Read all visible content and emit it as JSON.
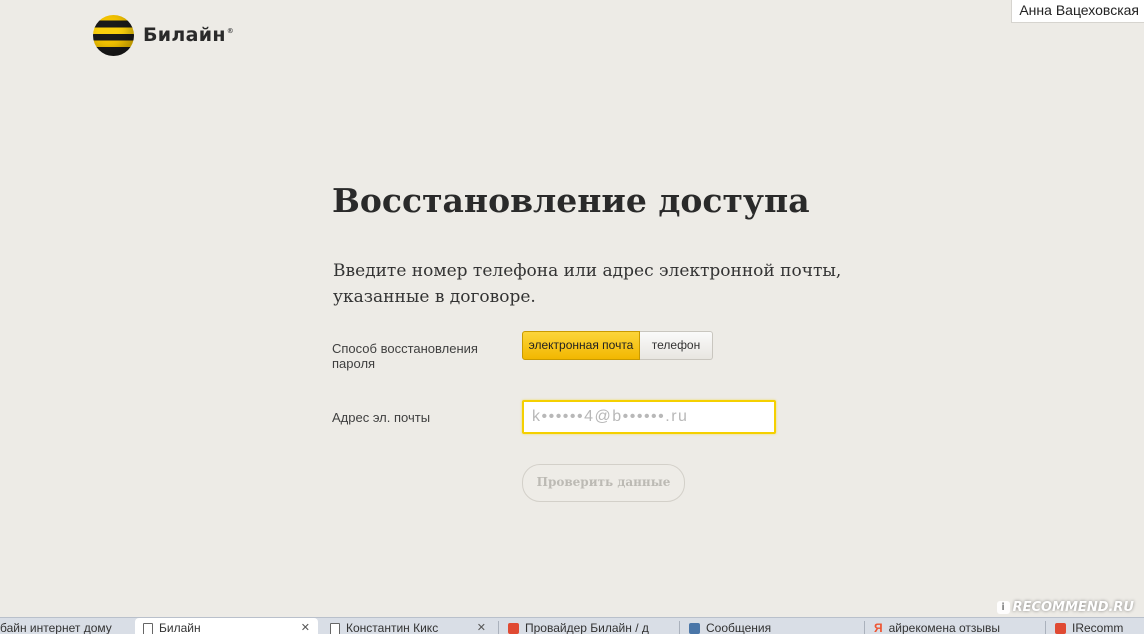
{
  "header": {
    "user_name": "Анна Вацеховская",
    "brand_name": "Билайн",
    "brand_reg_mark": "®"
  },
  "main": {
    "title": "Восстановление доступа",
    "intro": "Введите номер телефона или адрес электронной почты, указанные в договоре.",
    "recovery_method_label": "Способ восстановления пароля",
    "methods": [
      {
        "label": "электронная почта",
        "selected": true
      },
      {
        "label": "телефон",
        "selected": false
      }
    ],
    "email_label": "Адрес эл. почты",
    "email_placeholder": "k••••••4@b••••••.ru",
    "email_value": "",
    "submit_label": "Проверить данные",
    "submit_enabled": false
  },
  "taskbar": {
    "tabs": [
      {
        "label": "байн интернет дому",
        "icon": "none",
        "active": false
      },
      {
        "label": "Билайн",
        "icon": "document-icon",
        "active": true,
        "close": "✕"
      },
      {
        "label": "Константин Кикс",
        "icon": "document-icon",
        "active": false,
        "close": "✕"
      },
      {
        "label": "Провайдер Билайн / д",
        "icon": "red-tab-icon",
        "active": false
      },
      {
        "label": "Сообщения",
        "icon": "blue-tab-icon",
        "active": false
      },
      {
        "label": "айрекомена отзывы",
        "icon": "yandex-icon",
        "active": false
      },
      {
        "label": "IRecomm",
        "icon": "red-tab-icon",
        "active": false
      }
    ]
  },
  "watermark": {
    "text": "RECOMMEND.RU"
  },
  "colors": {
    "background": "#edebe6",
    "accent_yellow": "#f5c400",
    "input_border": "#f5d000"
  }
}
